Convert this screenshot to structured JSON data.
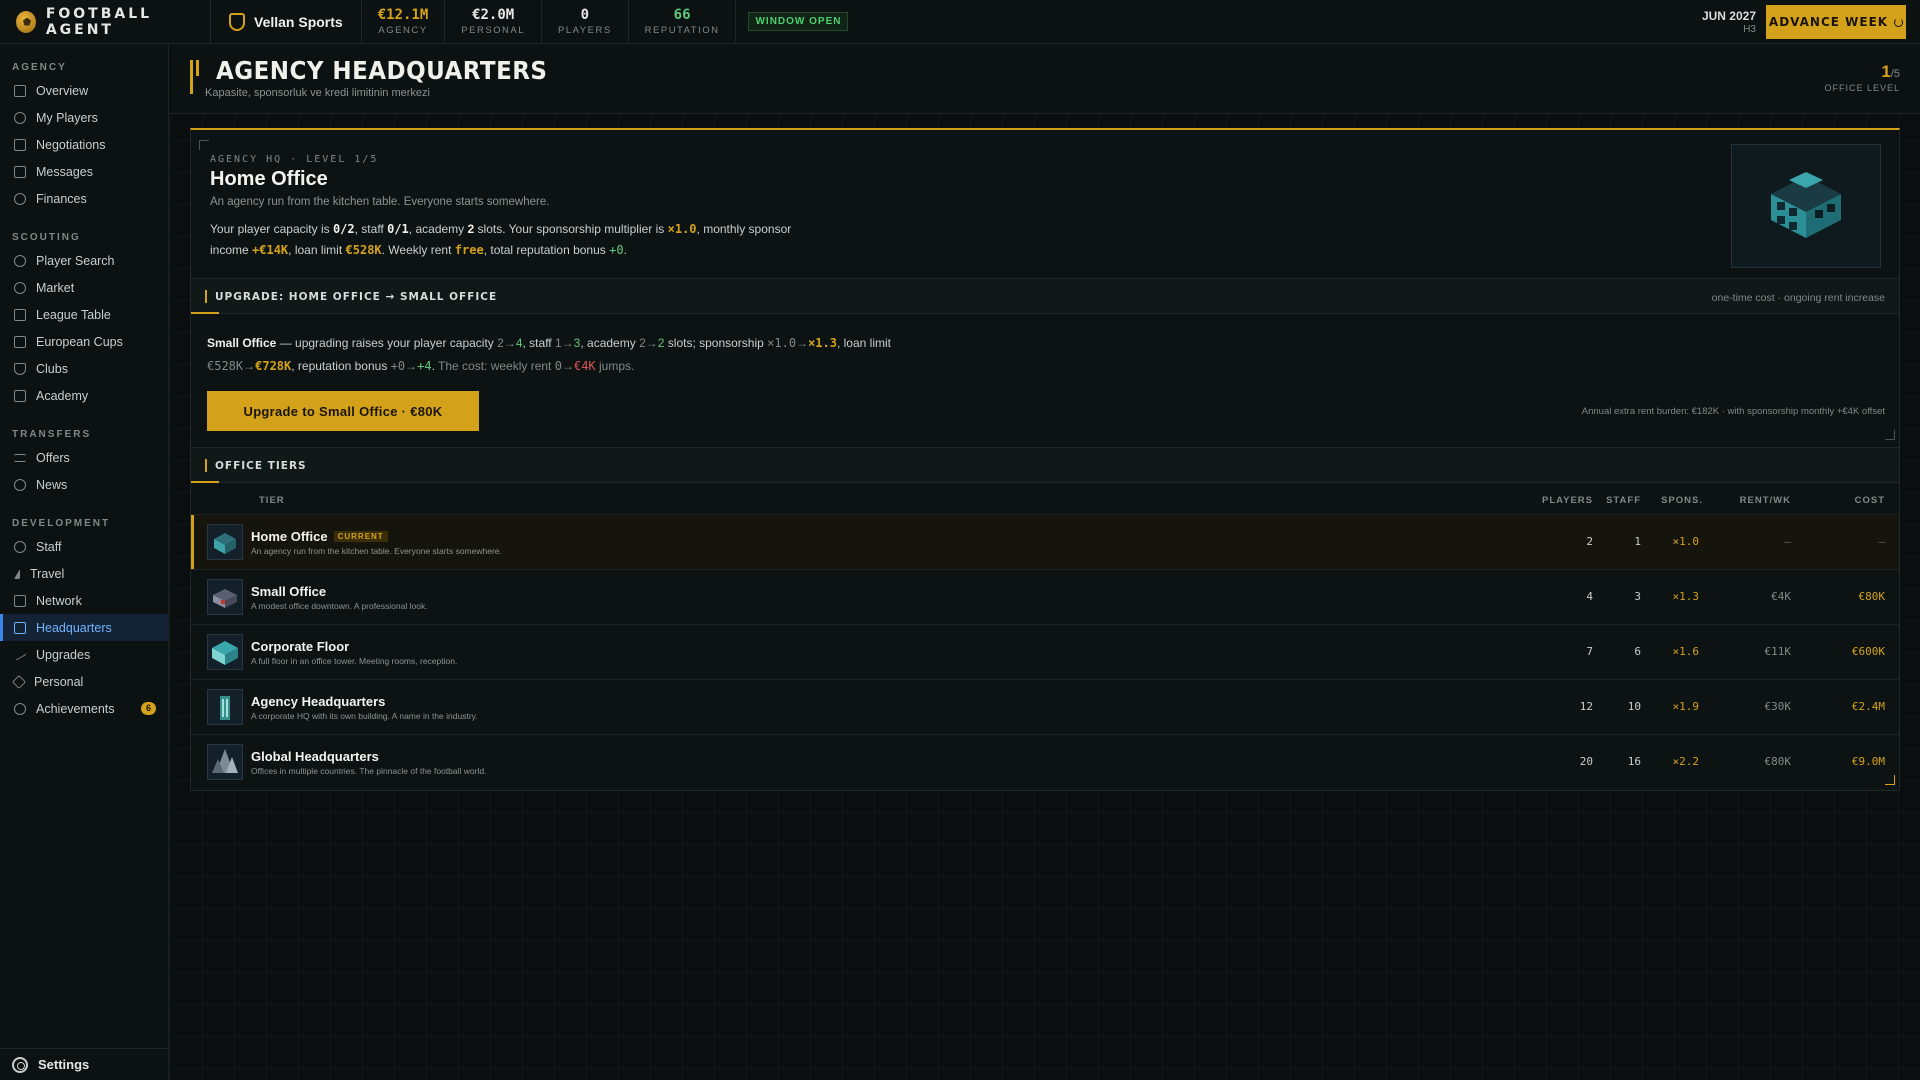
{
  "brand": {
    "name": "FOOTBALL AGENT"
  },
  "agency": {
    "name": "Vellan Sports"
  },
  "stats": [
    {
      "value": "€12.1M",
      "label": "AGENCY",
      "color": "#d4a21a"
    },
    {
      "value": "€2.0M",
      "label": "PERSONAL",
      "color": "#e5e7e4"
    },
    {
      "value": "0",
      "label": "PLAYERS",
      "color": "#e5e7e4"
    },
    {
      "value": "66",
      "label": "REPUTATION",
      "color": "#5fc97a"
    }
  ],
  "window_status": "WINDOW OPEN",
  "date": {
    "month": "JUN 2027",
    "half": "H3"
  },
  "advance_button": "ADVANCE WEEK",
  "sidebar": {
    "sections": [
      {
        "title": "AGENCY",
        "items": [
          "Overview",
          "My Players",
          "Negotiations",
          "Messages",
          "Finances"
        ]
      },
      {
        "title": "SCOUTING",
        "items": [
          "Player Search",
          "Market",
          "League Table",
          "European Cups",
          "Clubs",
          "Academy"
        ]
      },
      {
        "title": "TRANSFERS",
        "items": [
          "Offers",
          "News"
        ]
      },
      {
        "title": "DEVELOPMENT",
        "items": [
          "Staff",
          "Travel",
          "Network",
          "Headquarters",
          "Upgrades",
          "Personal",
          "Achievements"
        ]
      }
    ],
    "active": "Headquarters",
    "achievements_badge": "6",
    "settings": "Settings"
  },
  "page": {
    "title": "AGENCY HEADQUARTERS",
    "subtitle": "Kapasite, sponsorluk ve kredi limitinin merkezi",
    "office_level": "1",
    "office_level_max": "/5",
    "office_level_label": "OFFICE LEVEL"
  },
  "hq": {
    "meta": "AGENCY HQ · LEVEL 1/5",
    "name": "Home Office",
    "desc": "An agency run from the kitchen table. Everyone starts somewhere.",
    "capacity": "0/2",
    "staff": "0/1",
    "academy": "2",
    "multiplier": "×1.0",
    "income": "+€14K",
    "loan": "€528K",
    "rent": "free",
    "rep": "+0"
  },
  "upgrade": {
    "section_title": "UPGRADE: HOME OFFICE → SMALL OFFICE",
    "section_note": "one-time cost · ongoing rent increase",
    "target": "Small Office",
    "cap_from": "2",
    "cap_to": "4",
    "staff_from": "1",
    "staff_to": "3",
    "acad_from": "2",
    "acad_to": "2",
    "sp_from": "×1.0",
    "sp_to": "×1.3",
    "loan_from": "€528K",
    "loan_to": "€728K",
    "rep_from": "+0",
    "rep_to": "+4",
    "rent_from": "0",
    "rent_to": "€4K",
    "button": "Upgrade to Small Office · €80K",
    "note": "Annual extra rent burden: €182K · with sponsorship monthly +€4K offset"
  },
  "tiers": {
    "section_title": "OFFICE TIERS",
    "headers": {
      "tier": "TIER",
      "players": "PLAYERS",
      "staff": "STAFF",
      "spons": "SPONS.",
      "rent": "RENT/WK",
      "cost": "COST"
    },
    "current_tag": "CURRENT",
    "rows": [
      {
        "name": "Home Office",
        "desc": "An agency run from the kitchen table. Everyone starts somewhere.",
        "players": "2",
        "staff": "1",
        "spons": "×1.0",
        "rent": "—",
        "cost": "—",
        "current": true
      },
      {
        "name": "Small Office",
        "desc": "A modest office downtown. A professional look.",
        "players": "4",
        "staff": "3",
        "spons": "×1.3",
        "rent": "€4K",
        "cost": "€80K"
      },
      {
        "name": "Corporate Floor",
        "desc": "A full floor in an office tower. Meeting rooms, reception.",
        "players": "7",
        "staff": "6",
        "spons": "×1.6",
        "rent": "€11K",
        "cost": "€600K"
      },
      {
        "name": "Agency Headquarters",
        "desc": "A corporate HQ with its own building. A name in the industry.",
        "players": "12",
        "staff": "10",
        "spons": "×1.9",
        "rent": "€30K",
        "cost": "€2.4M"
      },
      {
        "name": "Global Headquarters",
        "desc": "Offices in multiple countries. The pinnacle of the football world.",
        "players": "20",
        "staff": "16",
        "spons": "×2.2",
        "rent": "€80K",
        "cost": "€9.0M"
      }
    ]
  }
}
